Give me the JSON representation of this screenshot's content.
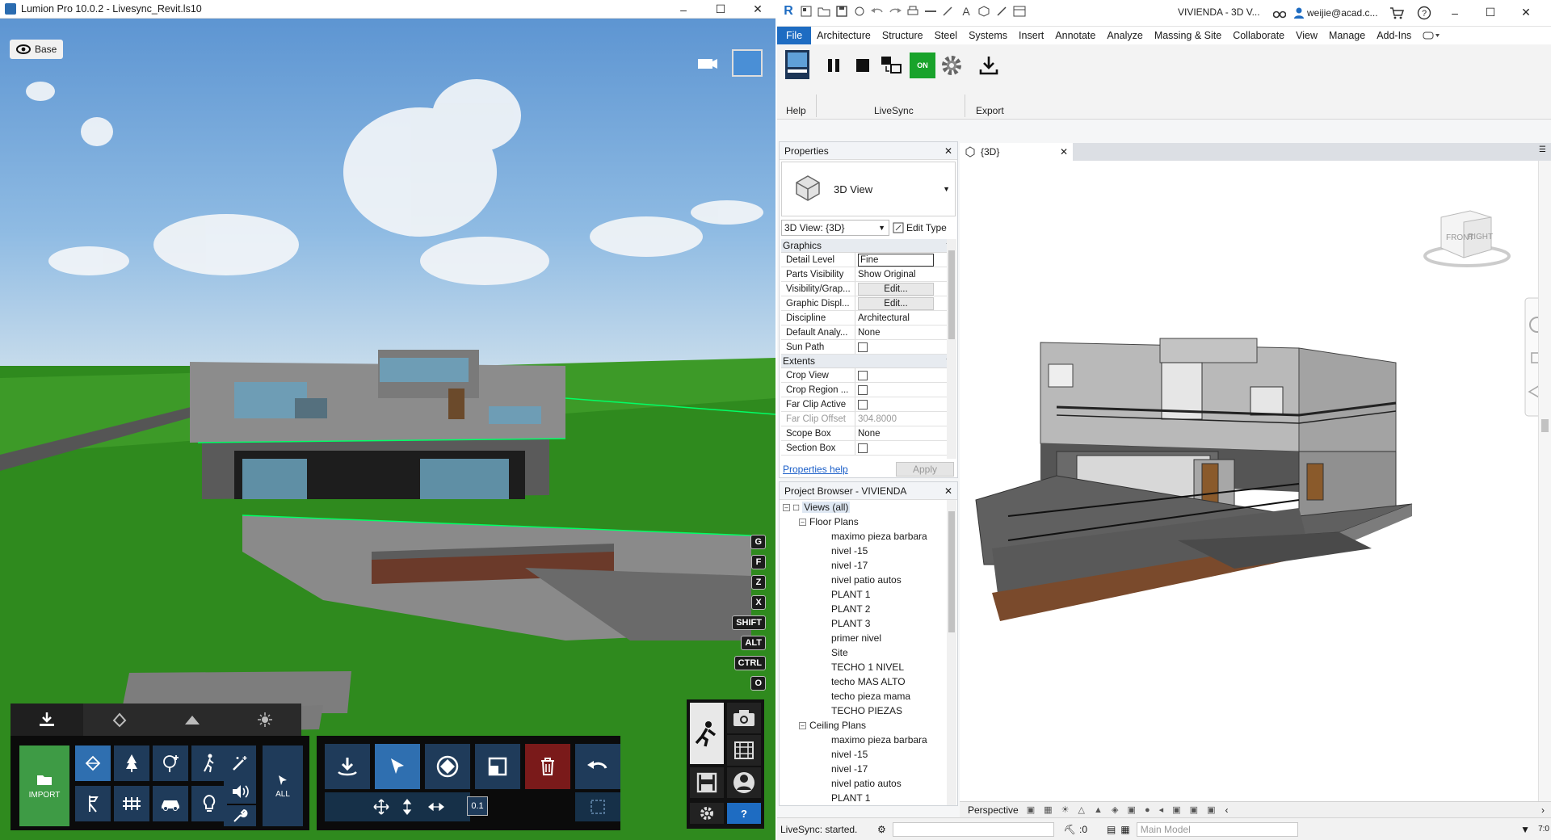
{
  "lumion": {
    "window_title": "Lumion Pro 10.0.2 - Livesync_Revit.ls10",
    "base_label": "Base",
    "key_hints": [
      "G",
      "F",
      "Z",
      "X",
      "SHIFT",
      "ALT",
      "CTRL",
      "O"
    ],
    "import_label": "IMPORT",
    "all_label": "ALL",
    "coord_value": "0.1",
    "icons": [
      "eye-icon",
      "video-camera-icon",
      "import-icon",
      "material-icon",
      "landscape-icon",
      "weather-icon",
      "nature-icon",
      "tree-icon",
      "add-tree-icon",
      "people-icon",
      "effects-icon",
      "indoor-icon",
      "utilities-icon",
      "transport-icon",
      "light-icon",
      "sound-icon",
      "tool-icon",
      "place-icon",
      "select-icon",
      "move-icon",
      "scale-icon",
      "delete-icon",
      "undo-icon",
      "photo-icon",
      "movie-icon",
      "save-icon",
      "panorama-icon",
      "settings-icon",
      "help-icon"
    ]
  },
  "revit": {
    "window_title": "VIVIENDA - 3D V...",
    "user": "weijie@acad.c...",
    "menu": [
      "File",
      "Architecture",
      "Structure",
      "Steel",
      "Systems",
      "Insert",
      "Annotate",
      "Analyze",
      "Massing & Site",
      "Collaborate",
      "View",
      "Manage",
      "Add-Ins"
    ],
    "ribbon": {
      "help_label": "Help",
      "livesync_label": "LiveSync",
      "export_label": "Export",
      "on_label": "ON"
    },
    "properties": {
      "title": "Properties",
      "type_name": "3D View",
      "view_selector": "3D View: {3D}",
      "edit_type": "Edit Type",
      "sections": [
        {
          "name": "Graphics",
          "rows": [
            {
              "key": "Detail Level",
              "value": "Fine",
              "kind": "input"
            },
            {
              "key": "Parts Visibility",
              "value": "Show Original",
              "kind": "text"
            },
            {
              "key": "Visibility/Grap...",
              "value": "Edit...",
              "kind": "button"
            },
            {
              "key": "Graphic Displ...",
              "value": "Edit...",
              "kind": "button"
            },
            {
              "key": "Discipline",
              "value": "Architectural",
              "kind": "text"
            },
            {
              "key": "Default Analy...",
              "value": "None",
              "kind": "text"
            },
            {
              "key": "Sun Path",
              "value": "",
              "kind": "check"
            }
          ]
        },
        {
          "name": "Extents",
          "rows": [
            {
              "key": "Crop View",
              "value": "",
              "kind": "check"
            },
            {
              "key": "Crop Region ...",
              "value": "",
              "kind": "check"
            },
            {
              "key": "Far Clip Active",
              "value": "",
              "kind": "check"
            },
            {
              "key": "Far Clip Offset",
              "value": "304.8000",
              "kind": "disabled"
            },
            {
              "key": "Scope Box",
              "value": "None",
              "kind": "text"
            },
            {
              "key": "Section Box",
              "value": "",
              "kind": "check"
            }
          ]
        }
      ],
      "help_link": "Properties help",
      "apply": "Apply"
    },
    "browser": {
      "title": "Project Browser - VIVIENDA",
      "root": "Views (all)",
      "groups": [
        {
          "name": "Floor Plans",
          "items": [
            "maximo pieza barbara",
            "nivel -15",
            "nivel -17",
            "nivel patio autos",
            "PLANT 1",
            "PLANT 2",
            "PLANT 3",
            "primer nivel",
            "Site",
            "TECHO 1 NIVEL",
            "techo  MAS ALTO",
            "techo pieza mama",
            "TECHO PIEZAS"
          ]
        },
        {
          "name": "Ceiling Plans",
          "items": [
            "maximo pieza barbara",
            "nivel -15",
            "nivel -17",
            "nivel patio autos",
            "PLANT 1"
          ]
        }
      ]
    },
    "view_tab": "{3D}",
    "view_cube": {
      "front": "FRONT",
      "right": "RIGHT"
    },
    "view_bar_label": "Perspective",
    "status_text": "LiveSync: started.",
    "selection_count": ":0",
    "model_selector": "Main Model",
    "filter_count": "7:0"
  },
  "colors": {
    "revit_accent": "#1e6cc2",
    "lumion_panel": "#1f3b5a",
    "lumion_selected": "#2f6fb0",
    "import_green": "#3e9b45",
    "livesync_on": "#19a32b"
  }
}
